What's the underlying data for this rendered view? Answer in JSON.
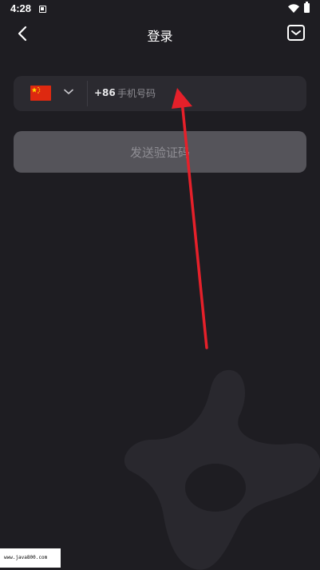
{
  "status_bar": {
    "time": "4:28",
    "icons": [
      "sim-card-icon",
      "wifi-icon",
      "battery-icon"
    ]
  },
  "header": {
    "title": "登录",
    "left_icon": "back-chevron-icon",
    "right_icon": "mail-icon"
  },
  "phone_form": {
    "country_flag": "china-flag-icon",
    "dial_code": "+86",
    "phone_placeholder": "手机号码",
    "phone_value": ""
  },
  "send_code_button": {
    "label": "发送验证码"
  },
  "watermark": {
    "text": "www.java800.com"
  },
  "colors": {
    "background": "#1e1d22",
    "card": "#2b2a30",
    "button_disabled": "#55545a",
    "arrow": "#e5202a"
  }
}
